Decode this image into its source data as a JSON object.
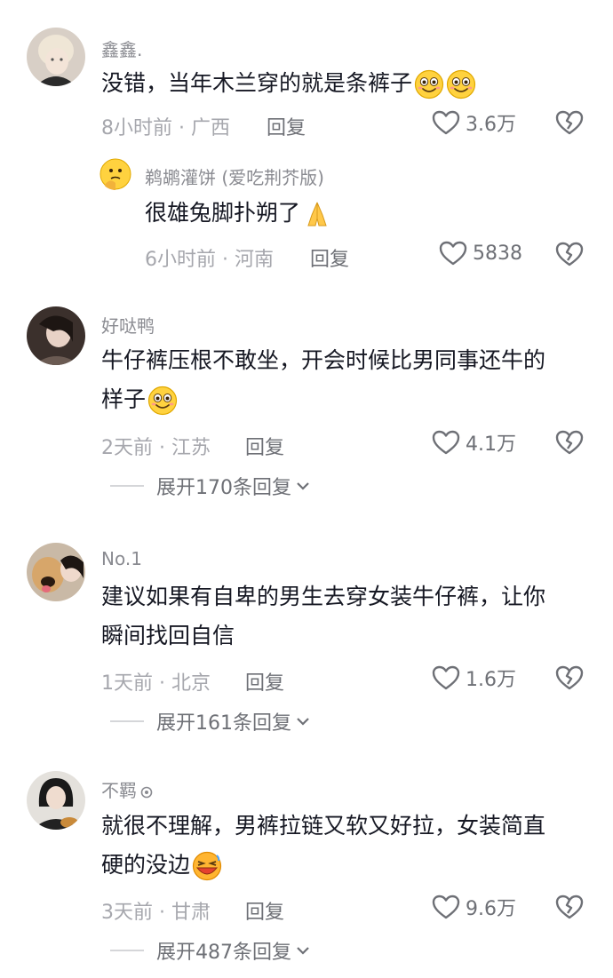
{
  "comments": [
    {
      "username": "鑫鑫.",
      "text": "没错，当年木兰穿的就是条裤子",
      "meta": "8小时前 · 广西",
      "reply_label": "回复",
      "likes": "3.6万",
      "replies": [
        {
          "username": "鹈鹕灌饼 (爱吃荆芥版)",
          "text": "很雄兔脚扑朔了",
          "meta": "6小时前 · 河南",
          "reply_label": "回复",
          "likes": "5838"
        }
      ]
    },
    {
      "username": "好哒鸭",
      "text_line1": "牛仔裤压根不敢坐，开会时候比男同事还牛的",
      "text_line2": "样子",
      "meta": "2天前 · 江苏",
      "reply_label": "回复",
      "likes": "4.1万",
      "expand_label": "展开170条回复"
    },
    {
      "username": "No.1",
      "text_line1": "建议如果有自卑的男生去穿女装牛仔裤，让你",
      "text_line2": "瞬间找回自信",
      "meta": "1天前 · 北京",
      "reply_label": "回复",
      "likes": "1.6万",
      "expand_label": "展开161条回复"
    },
    {
      "username": "不羁",
      "text_line1": "就很不理解，男裤拉链又软又好拉，女装简直",
      "text_line2": "硬的没边",
      "meta": "3天前 · 甘肃",
      "reply_label": "回复",
      "likes": "9.6万",
      "expand_label": "展开487条回复"
    }
  ],
  "icons": {
    "like": "heart-outline-icon",
    "dislike": "broken-heart-icon",
    "expand": "chevron-down-icon"
  },
  "colors": {
    "text": "#161823",
    "meta": "#a6a7ad",
    "username": "#8a8b91"
  }
}
